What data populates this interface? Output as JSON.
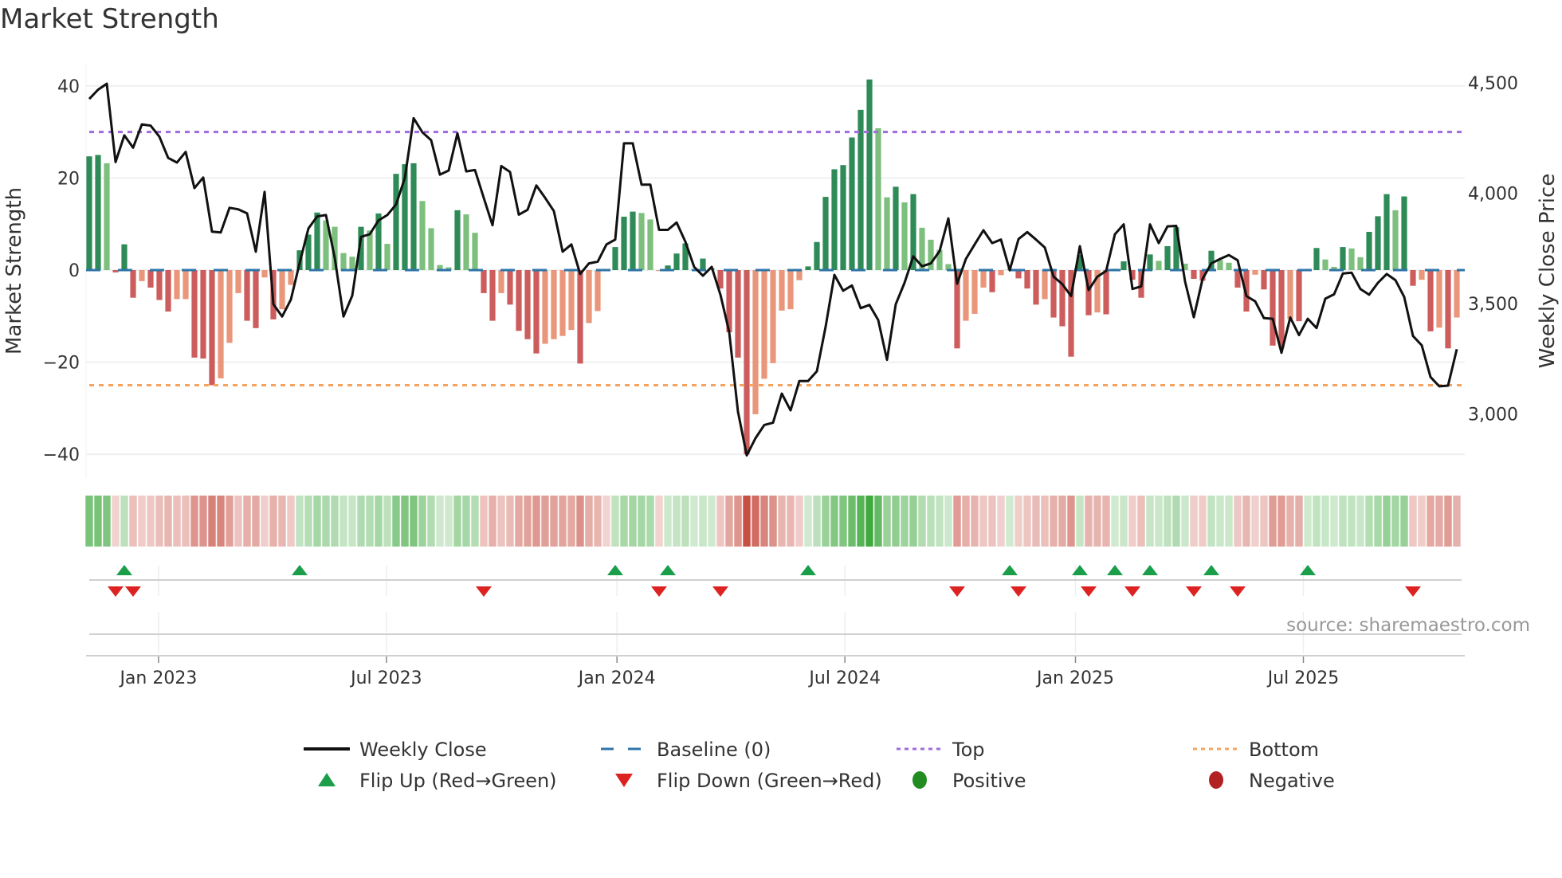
{
  "title": "Market Strength",
  "source": "source: sharemaestro.com",
  "colors": {
    "strong_positive": "#2e8b57",
    "weak_positive": "#7dbf7d",
    "strong_negative": "#cd5c5c",
    "weak_negative": "#e9967a",
    "line": "#111111",
    "baseline": "#2f75a8",
    "top": "#a06be0",
    "bottom": "#f4a460",
    "flip_up": "#1a9e4a",
    "flip_down": "#dd2222",
    "positive": "#228b22",
    "negative": "#b22222"
  },
  "chart_data": {
    "type": "bar",
    "title": "Market Strength",
    "start_week": "2022-11-06",
    "frequency": "weekly",
    "ylabel": "Market Strength",
    "y2label": "Weekly Close Price",
    "ylim": [
      -45,
      45
    ],
    "y2lim": [
      2740,
      4600
    ],
    "yticks": [
      {
        "v": 40,
        "label": "40"
      },
      {
        "v": 20,
        "label": "20"
      },
      {
        "v": 0,
        "label": "0"
      },
      {
        "v": -20,
        "label": "−20"
      },
      {
        "v": -40,
        "label": "−40"
      }
    ],
    "y2ticks": [
      {
        "v": 4500,
        "label": "4,500"
      },
      {
        "v": 4000,
        "label": "4,000"
      },
      {
        "v": 3500,
        "label": "3,500"
      },
      {
        "v": 3000,
        "label": "3,000"
      }
    ],
    "xticks": [
      {
        "week": 7.9,
        "label": "Jan 2023"
      },
      {
        "week": 33.9,
        "label": "Jul 2023"
      },
      {
        "week": 60.2,
        "label": "Jan 2024"
      },
      {
        "week": 86.2,
        "label": "Jul 2024"
      },
      {
        "week": 112.5,
        "label": "Jan 2025"
      },
      {
        "week": 138.5,
        "label": "Jul 2025"
      }
    ],
    "top_level": 30,
    "bottom_level": -25,
    "baseline": 0,
    "strength": [
      24.7,
      25.0,
      23.2,
      -0.5,
      5.6,
      -6,
      -2.4,
      -3.8,
      -6.5,
      -9,
      -6.3,
      -6.3,
      -19,
      -19.2,
      -25,
      -23.5,
      -15.8,
      -5,
      -11,
      -12.6,
      -1.6,
      -10.7,
      -8.5,
      -3.2,
      4.3,
      7.7,
      12.5,
      10.8,
      9.4,
      3.7,
      2.9,
      9.4,
      8.6,
      12.3,
      5.7,
      20.9,
      23,
      23.2,
      15,
      9.1,
      1.1,
      0.6,
      13,
      12.1,
      8.1,
      -5,
      -11,
      -5,
      -7.5,
      -13.2,
      -15,
      -18.1,
      -16,
      -15,
      -14.3,
      -13,
      -20.3,
      -11.5,
      -8.9,
      -0.2,
      5,
      11.6,
      12.7,
      12.4,
      11,
      -0.2,
      1,
      3.6,
      5.8,
      0.2,
      2.5,
      0.5,
      -4,
      -13.5,
      -19,
      -40,
      -31.3,
      -23.6,
      -20.2,
      -8.8,
      -8.5,
      -2.2,
      0.8,
      6.1,
      15.9,
      21.9,
      22.8,
      28.8,
      34.8,
      41.4,
      30.8,
      15.8,
      18.1,
      14.7,
      16.5,
      9.2,
      6.6,
      4.4,
      1.3,
      -17,
      -11,
      -9.5,
      -3.8,
      -4.8,
      -1.1,
      0.3,
      -1.8,
      -4,
      -7.5,
      -6.3,
      -10.3,
      -12.2,
      -18.8,
      3.3,
      -9.8,
      -9.2,
      -9.6,
      0.3,
      1.9,
      -2.1,
      -6,
      3.4,
      2,
      5.2,
      9.3,
      1.4,
      -1.9,
      -2.3,
      4.2,
      2.2,
      1.6,
      -3.8,
      -9,
      -1,
      -4.2,
      -16.4,
      -16.8,
      -10.6,
      -11.1,
      0.1,
      4.8,
      2.3,
      0.7,
      5,
      4.7,
      2.8,
      8.3,
      11.7,
      16.5,
      13,
      16,
      -3.4,
      -2.1,
      -13.3,
      -12.5,
      -17,
      -10.3
    ],
    "strong": [
      1,
      1,
      0,
      1,
      1,
      1,
      0,
      1,
      1,
      1,
      0,
      0,
      1,
      1,
      1,
      0,
      0,
      0,
      1,
      1,
      0,
      1,
      0,
      0,
      1,
      1,
      1,
      0,
      0,
      0,
      0,
      1,
      0,
      1,
      0,
      1,
      1,
      1,
      0,
      0,
      0,
      0,
      1,
      0,
      0,
      1,
      1,
      0,
      1,
      1,
      1,
      1,
      0,
      0,
      0,
      0,
      1,
      0,
      0,
      0,
      1,
      1,
      1,
      0,
      0,
      0,
      1,
      1,
      1,
      0,
      1,
      0,
      1,
      1,
      1,
      1,
      0,
      0,
      0,
      0,
      0,
      0,
      1,
      1,
      1,
      1,
      1,
      1,
      1,
      1,
      0,
      0,
      1,
      0,
      1,
      0,
      0,
      0,
      0,
      1,
      0,
      0,
      0,
      1,
      0,
      0,
      1,
      1,
      1,
      0,
      1,
      1,
      1,
      1,
      1,
      0,
      1,
      0,
      1,
      1,
      1,
      1,
      0,
      1,
      1,
      0,
      1,
      1,
      1,
      0,
      0,
      1,
      1,
      0,
      1,
      1,
      1,
      0,
      1,
      0,
      1,
      0,
      0,
      1,
      0,
      0,
      1,
      1,
      1,
      0,
      1,
      1,
      0,
      1,
      0,
      1,
      0
    ],
    "weekly_close": [
      4427,
      4469,
      4496,
      4141,
      4262,
      4206,
      4312,
      4306,
      4256,
      4160,
      4139,
      4187,
      4023,
      4071,
      3826,
      3822,
      3934,
      3927,
      3909,
      3735,
      4006,
      3497,
      3441,
      3518,
      3684,
      3840,
      3895,
      3901,
      3708,
      3441,
      3536,
      3802,
      3814,
      3877,
      3901,
      3949,
      4069,
      4340,
      4276,
      4240,
      4084,
      4103,
      4271,
      4099,
      4105,
      3979,
      3855,
      4123,
      4096,
      3903,
      3925,
      4035,
      3979,
      3919,
      3735,
      3768,
      3634,
      3682,
      3690,
      3768,
      3790,
      4226,
      4226,
      4039,
      4039,
      3834,
      3834,
      3867,
      3780,
      3666,
      3626,
      3666,
      3540,
      3371,
      3010,
      2812,
      2890,
      2950,
      2960,
      3092,
      3016,
      3149,
      3149,
      3193,
      3395,
      3630,
      3558,
      3582,
      3479,
      3494,
      3425,
      3245,
      3497,
      3594,
      3714,
      3669,
      3682,
      3738,
      3886,
      3590,
      3702,
      3768,
      3832,
      3774,
      3790,
      3651,
      3792,
      3824,
      3790,
      3754,
      3622,
      3588,
      3534,
      3760,
      3561,
      3622,
      3648,
      3814,
      3859,
      3566,
      3578,
      3859,
      3774,
      3850,
      3852,
      3600,
      3438,
      3612,
      3682,
      3702,
      3720,
      3696,
      3534,
      3510,
      3434,
      3431,
      3277,
      3437,
      3357,
      3431,
      3389,
      3522,
      3542,
      3636,
      3640,
      3566,
      3540,
      3594,
      3634,
      3606,
      3530,
      3353,
      3311,
      3167,
      3125,
      3128,
      3293
    ],
    "legend": [
      {
        "key": "line",
        "label": "Weekly Close"
      },
      {
        "key": "baseline",
        "label": "Baseline (0)"
      },
      {
        "key": "top",
        "label": "Top"
      },
      {
        "key": "bottom",
        "label": "Bottom"
      },
      {
        "key": "flip_up",
        "label": "Flip Up (Red→Green)"
      },
      {
        "key": "flip_down",
        "label": "Flip Down (Green→Red)"
      },
      {
        "key": "positive",
        "label": "Positive"
      },
      {
        "key": "negative",
        "label": "Negative"
      }
    ]
  }
}
